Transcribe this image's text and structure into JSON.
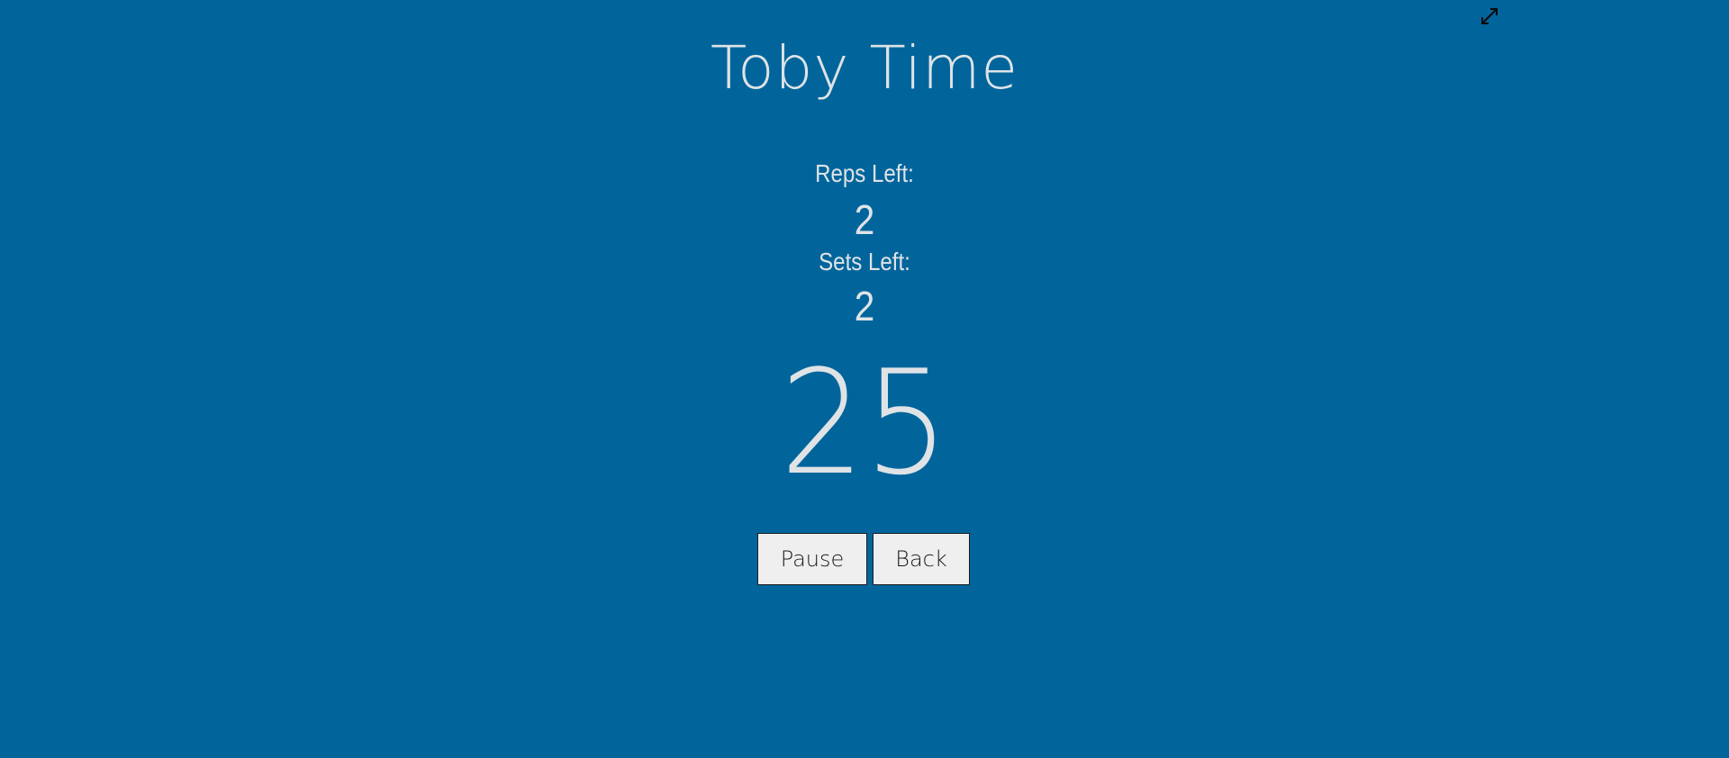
{
  "app": {
    "title": "Toby Time"
  },
  "stats": {
    "reps_label": "Reps Left:",
    "reps_value": "2",
    "sets_label": "Sets Left:",
    "sets_value": "2"
  },
  "timer": {
    "countdown": "25"
  },
  "controls": {
    "pause_label": "Pause",
    "back_label": "Back"
  },
  "icons": {
    "fullscreen": "fullscreen-expand-icon"
  },
  "colors": {
    "background": "#01659c",
    "text": "#dfe3e6",
    "button_bg": "#efefef",
    "button_text": "#1b1b1b"
  }
}
